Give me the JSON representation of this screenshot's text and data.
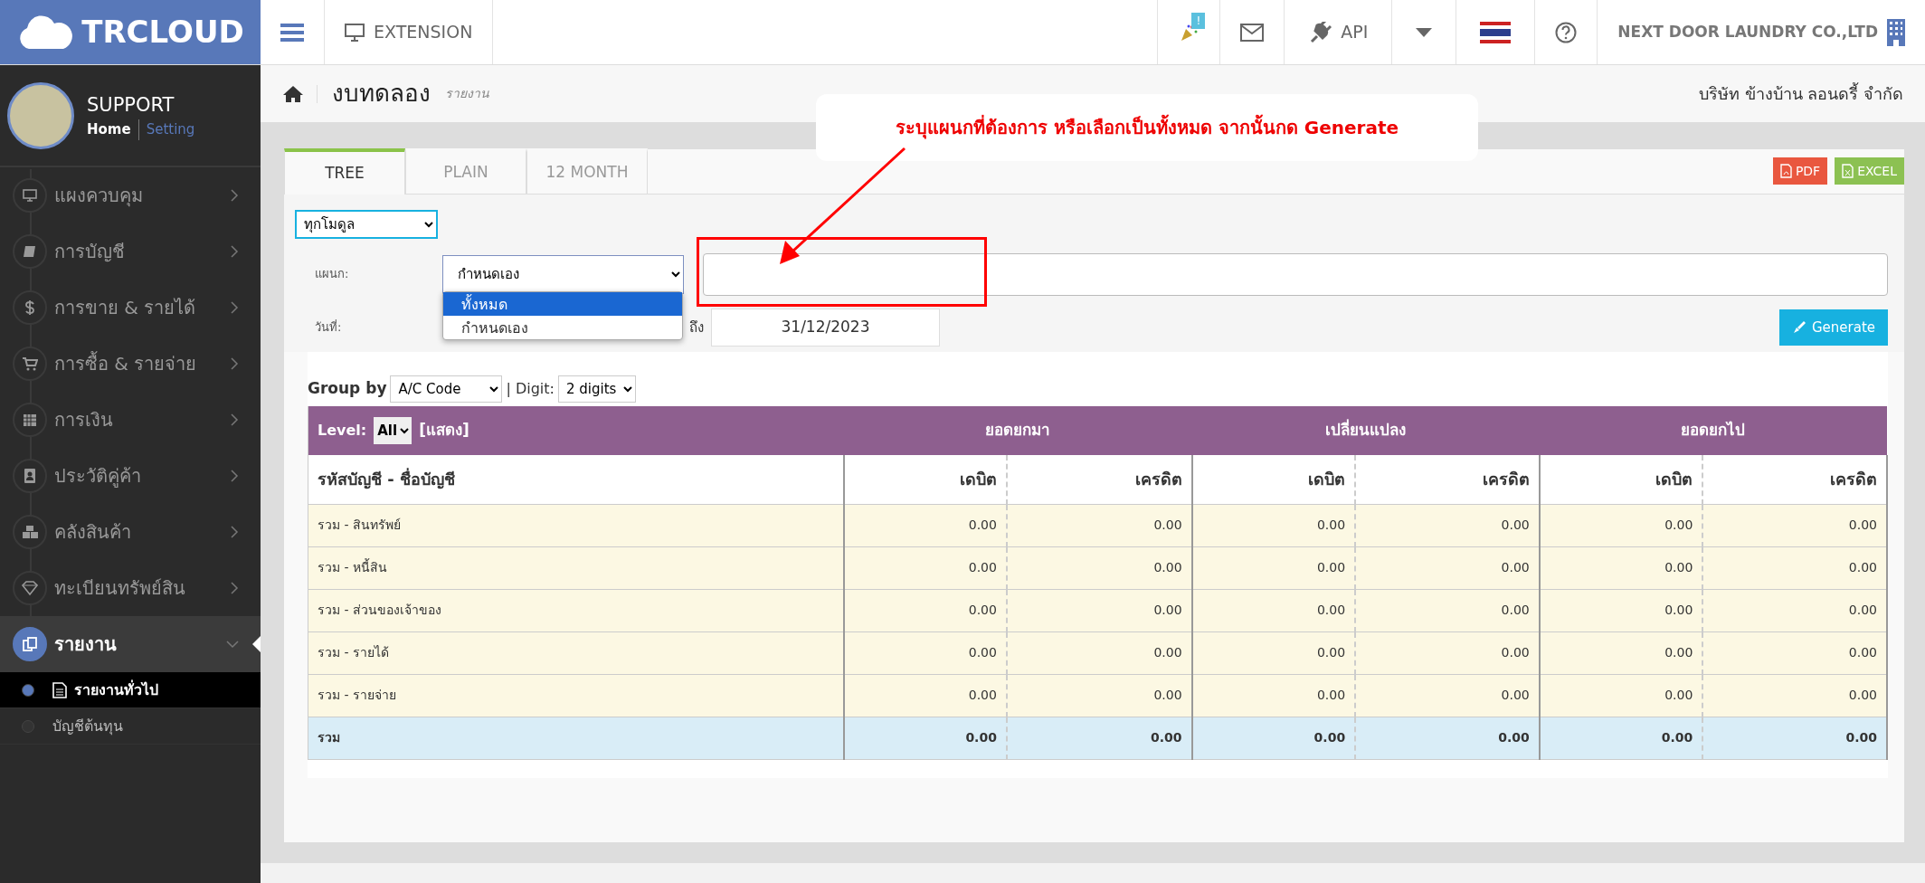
{
  "header": {
    "logo": "TRCLOUD",
    "extension": "EXTENSION",
    "notification_badge": "!",
    "api": "API",
    "company": "NEXT DOOR LAUNDRY CO.,LTD"
  },
  "sidebar": {
    "user": "SUPPORT",
    "links": [
      "Home",
      "Setting"
    ],
    "items": [
      {
        "label": "แผงควบคุม",
        "expanded": false
      },
      {
        "label": "การบัญชี",
        "expanded": false
      },
      {
        "label": "การขาย & รายได้",
        "expanded": false
      },
      {
        "label": "การซื้อ & รายจ่าย",
        "expanded": false
      },
      {
        "label": "การเงิน",
        "expanded": false
      },
      {
        "label": "ประวัติคู่ค้า",
        "expanded": false
      },
      {
        "label": "คลังสินค้า",
        "expanded": false
      },
      {
        "label": "ทะเบียนทรัพย์สิน",
        "expanded": false
      },
      {
        "label": "รายงาน",
        "expanded": true,
        "children": [
          {
            "label": "รายงานทั่วไป",
            "selected": true
          },
          {
            "label": "บัญชีต้นทุน",
            "selected": false
          }
        ]
      }
    ]
  },
  "breadcrumb": {
    "title": "งบทดลอง",
    "subtitle": "รายงาน",
    "company": "บริษัท ข้างบ้าน ลอนดรี้ จำกัด"
  },
  "annotation": {
    "text": "ระบุแผนกที่ต้องการ หรือเลือกเป็นทั้งหมด จากนั้นกด Generate"
  },
  "tabs": [
    {
      "label": "TREE",
      "selected": true
    },
    {
      "label": "PLAIN",
      "selected": false
    },
    {
      "label": "12 MONTH",
      "selected": false
    }
  ],
  "export_buttons": [
    {
      "kind": "pdf",
      "label": "PDF"
    },
    {
      "kind": "excel",
      "label": "EXCEL"
    }
  ],
  "filters": {
    "module": "ทุกโมดูล",
    "department_label": "แผนก:",
    "department": "กำหนดเอง",
    "department_options": [
      {
        "label": "ทั้งหมด",
        "selected": true
      },
      {
        "label": "กำหนดเอง",
        "selected": false
      }
    ],
    "date_label": "วันที่:",
    "to_label": "ถึง",
    "date_to": "31/12/2023",
    "generate": "Generate"
  },
  "report": {
    "group_by_label": "Group by",
    "group_by": "A/C Code",
    "digit_label": "| Digit:",
    "digit": "2 digits",
    "level_label": "Level:",
    "level": "All",
    "show_link": "[แสดง]",
    "column_groups": [
      "ยอดยกมา",
      "เปลี่ยนแปลง",
      "ยอดยกไป"
    ],
    "columns": [
      "รหัสบัญชี - ชื่อบัญชี",
      "เดบิต",
      "เครดิต",
      "เดบิต",
      "เครดิต",
      "เดบิต",
      "เครดิต"
    ],
    "rows": [
      {
        "kind": "group",
        "cells": [
          "รวม - สินทรัพย์",
          "0.00",
          "0.00",
          "0.00",
          "0.00",
          "0.00",
          "0.00"
        ]
      },
      {
        "kind": "group",
        "cells": [
          "รวม - หนี้สิน",
          "0.00",
          "0.00",
          "0.00",
          "0.00",
          "0.00",
          "0.00"
        ]
      },
      {
        "kind": "group",
        "cells": [
          "รวม - ส่วนของเจ้าของ",
          "0.00",
          "0.00",
          "0.00",
          "0.00",
          "0.00",
          "0.00"
        ]
      },
      {
        "kind": "group",
        "cells": [
          "รวม - รายได้",
          "0.00",
          "0.00",
          "0.00",
          "0.00",
          "0.00",
          "0.00"
        ]
      },
      {
        "kind": "group",
        "cells": [
          "รวม - รายจ่าย",
          "0.00",
          "0.00",
          "0.00",
          "0.00",
          "0.00",
          "0.00"
        ]
      },
      {
        "kind": "total",
        "cells": [
          "รวม",
          "0.00",
          "0.00",
          "0.00",
          "0.00",
          "0.00",
          "0.00"
        ]
      }
    ]
  }
}
